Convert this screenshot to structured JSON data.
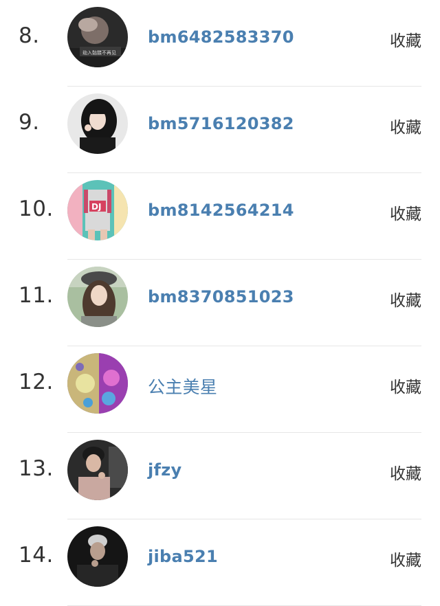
{
  "users": [
    {
      "rank": "8.",
      "name": "bm6482583370",
      "action": "收藏",
      "avatar_caption": "劫入骷髅不再见"
    },
    {
      "rank": "9.",
      "name": "bm5716120382",
      "action": "收藏"
    },
    {
      "rank": "10.",
      "name": "bm8142564214",
      "action": "收藏",
      "avatar_caption": "DJ"
    },
    {
      "rank": "11.",
      "name": "bm8370851023",
      "action": "收藏"
    },
    {
      "rank": "12.",
      "name": "公主美星",
      "action": "收藏"
    },
    {
      "rank": "13.",
      "name": "jfzy",
      "action": "收藏"
    },
    {
      "rank": "14.",
      "name": "jiba521",
      "action": "收藏"
    }
  ],
  "colors": {
    "username": "#4a7fb0",
    "text": "#333333",
    "divider": "#e6e6e6"
  }
}
